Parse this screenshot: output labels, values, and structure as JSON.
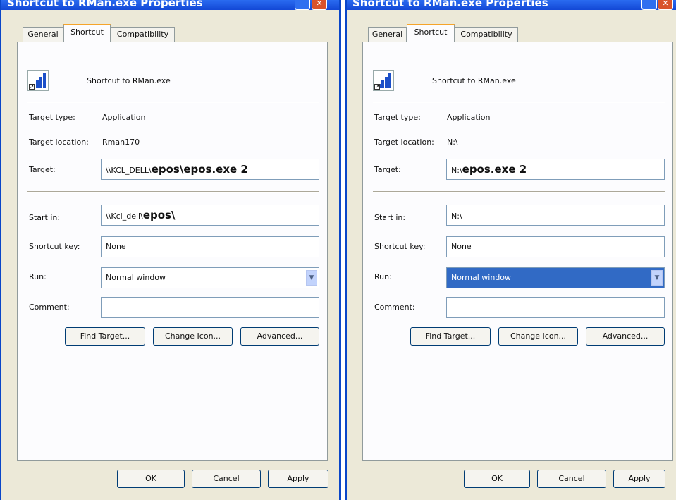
{
  "windows": [
    {
      "title": "Shortcut to RMan.exe Properties",
      "tabs": [
        "General",
        "Shortcut",
        "Compatibility"
      ],
      "icon_name": "Shortcut to RMan.exe",
      "target_type_label": "Target type:",
      "target_type": "Application",
      "target_location_label": "Target location:",
      "target_location": "Rman170",
      "target_label": "Target:",
      "target_prefix": "\\\\KCL_DELL\\",
      "target_bold": "epos\\epos.exe 2",
      "start_in_label": "Start in:",
      "start_in_prefix": "\\\\Kcl_dell\\",
      "start_in_bold": "epos\\",
      "shortcut_key_label": "Shortcut key:",
      "shortcut_key": "None",
      "run_label": "Run:",
      "run": "Normal window",
      "comment_label": "Comment:",
      "comment": "",
      "find_target": "Find Target...",
      "change_icon": "Change Icon...",
      "advanced": "Advanced...",
      "ok": "OK",
      "cancel": "Cancel",
      "apply": "Apply"
    },
    {
      "title": "Shortcut to RMan.exe Properties",
      "tabs": [
        "General",
        "Shortcut",
        "Compatibility"
      ],
      "icon_name": "Shortcut to RMan.exe",
      "target_type_label": "Target type:",
      "target_type": "Application",
      "target_location_label": "Target location:",
      "target_location": "N:\\",
      "target_label": "Target:",
      "target_prefix": "N:\\",
      "target_bold": "epos.exe 2",
      "start_in_label": "Start in:",
      "start_in_prefix": "N:\\",
      "start_in_bold": "",
      "shortcut_key_label": "Shortcut key:",
      "shortcut_key": "None",
      "run_label": "Run:",
      "run": "Normal window",
      "comment_label": "Comment:",
      "comment": "",
      "find_target": "Find Target...",
      "change_icon": "Change Icon...",
      "advanced": "Advanced...",
      "ok": "OK",
      "cancel": "Cancel",
      "apply": "Apply"
    }
  ],
  "colors": {
    "titlebar": "#1348d6",
    "dialog_bg": "#ece9d8",
    "selection": "#316ac5",
    "active_tab_accent": "#f5a42a"
  }
}
